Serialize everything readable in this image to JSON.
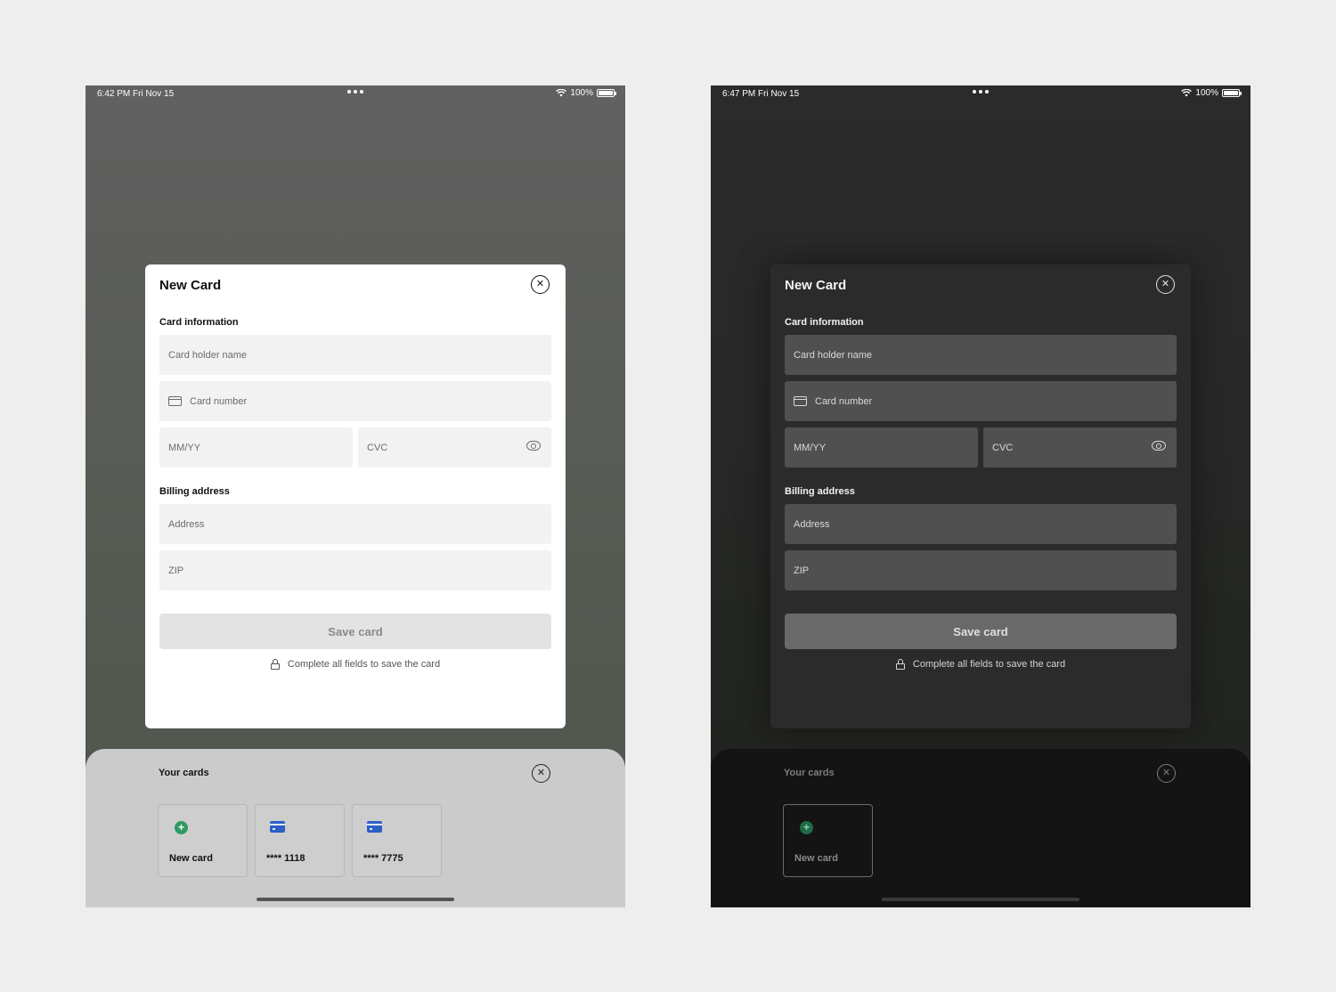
{
  "colors": {
    "page_bg": "#eeeeee",
    "new_card_green": "#2e9a62",
    "card_blue": "#2e5fc6"
  },
  "light": {
    "status": {
      "time": "6:42 PM   Fri Nov 15",
      "battery": "100%"
    },
    "modal": {
      "title": "New Card",
      "card_info_label": "Card information",
      "holder_placeholder": "Card holder name",
      "number_placeholder": "Card number",
      "expiry_placeholder": "MM/YY",
      "cvc_placeholder": "CVC",
      "billing_label": "Billing address",
      "address_placeholder": "Address",
      "zip_placeholder": "ZIP",
      "save_label": "Save card",
      "hint": "Complete all fields to save the card"
    },
    "sheet": {
      "title": "Your cards",
      "cards": [
        {
          "label": "New card",
          "icon": "plus-circle-icon"
        },
        {
          "label": "**** 1118",
          "icon": "credit-card-icon"
        },
        {
          "label": "**** 7775",
          "icon": "credit-card-icon"
        }
      ]
    }
  },
  "dark": {
    "status": {
      "time": "6:47 PM   Fri Nov 15",
      "battery": "100%"
    },
    "modal": {
      "title": "New Card",
      "card_info_label": "Card information",
      "holder_placeholder": "Card holder name",
      "number_placeholder": "Card number",
      "expiry_placeholder": "MM/YY",
      "cvc_placeholder": "CVC",
      "billing_label": "Billing address",
      "address_placeholder": "Address",
      "zip_placeholder": "ZIP",
      "save_label": "Save card",
      "hint": "Complete all fields to save the card"
    },
    "sheet": {
      "title": "Your cards",
      "cards": [
        {
          "label": "New card",
          "icon": "plus-circle-icon"
        }
      ]
    }
  }
}
